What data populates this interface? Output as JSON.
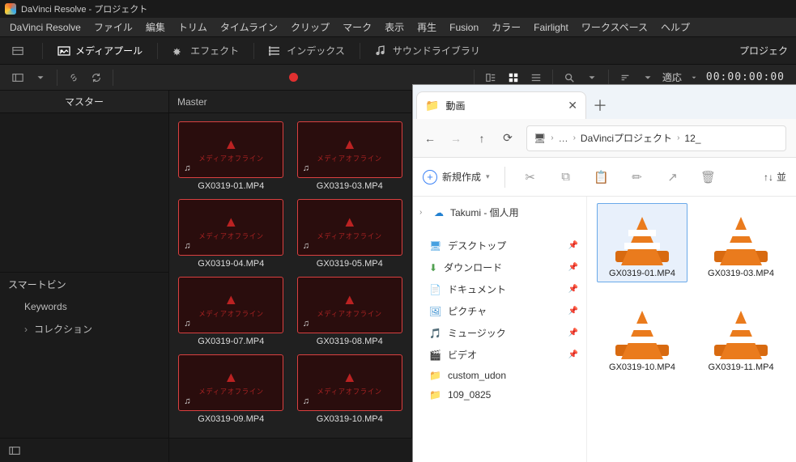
{
  "titlebar": {
    "title": "DaVinci Resolve - プロジェクト"
  },
  "menubar": [
    "DaVinci Resolve",
    "ファイル",
    "編集",
    "トリム",
    "タイムライン",
    "クリップ",
    "マーク",
    "表示",
    "再生",
    "Fusion",
    "カラー",
    "Fairlight",
    "ワークスペース",
    "ヘルプ"
  ],
  "wsbar": {
    "mediapool": "メディアプール",
    "effects": "エフェクト",
    "index": "インデックス",
    "soundlib": "サウンドライブラリ",
    "project": "プロジェク"
  },
  "tbar2": {
    "fit": "適応",
    "timecode": "00:00:00:00"
  },
  "left": {
    "master": "マスター",
    "smartbin": "スマートビン",
    "keywords": "Keywords",
    "collection": "コレクション"
  },
  "mediapool": {
    "header": "Master",
    "offline_text": "メディアオフライン",
    "clips": [
      "GX0319-01.MP4",
      "GX0319-03.MP4",
      "GX0319-04.MP4",
      "GX0319-05.MP4",
      "GX0319-07.MP4",
      "GX0319-08.MP4",
      "GX0319-09.MP4",
      "GX0319-10.MP4"
    ]
  },
  "explorer": {
    "tab_title": "動画",
    "new_btn": "新規作成",
    "sort": "並",
    "breadcrumb": {
      "dots": "…",
      "a": "DaVinciプロジェクト",
      "b": "12_"
    },
    "onedrive": "Takumi - 個人用",
    "quick": [
      {
        "label": "デスクトップ",
        "icon": "desk"
      },
      {
        "label": "ダウンロード",
        "icon": "down"
      },
      {
        "label": "ドキュメント",
        "icon": "doc"
      },
      {
        "label": "ピクチャ",
        "icon": "pic"
      },
      {
        "label": "ミュージック",
        "icon": "mus"
      },
      {
        "label": "ビデオ",
        "icon": "vid"
      },
      {
        "label": "custom_udon",
        "icon": "fld"
      },
      {
        "label": "109_0825",
        "icon": "fld"
      }
    ],
    "files": [
      {
        "name": "GX0319-01.MP4",
        "selected": true
      },
      {
        "name": "GX0319-03.MP4",
        "selected": false
      },
      {
        "name": "GX0319-10.MP4",
        "selected": false
      },
      {
        "name": "GX0319-11.MP4",
        "selected": false
      }
    ]
  }
}
